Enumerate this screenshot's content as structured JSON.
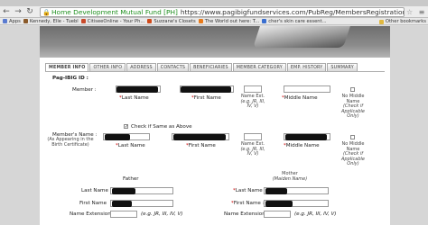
{
  "browser": {
    "site_name": "Home Development Mutual Fund [PH]",
    "url": "https://www.pagibigfundservices.com/PubReg/MembersRegistration/Registr",
    "bookmarks": [
      {
        "label": "Apps",
        "color": "#5a7bd0"
      },
      {
        "label": "Kennedy, Elle - Tuebl",
        "color": "#8a5a2a"
      },
      {
        "label": "CitiseeOnline - Your Ph...",
        "color": "#c94a2a"
      },
      {
        "label": "Suzzane's Closets",
        "color": "#d04a1a"
      },
      {
        "label": "The World out here: T...",
        "color": "#e87a1a"
      },
      {
        "label": "cher's skin care essent...",
        "color": "#3a6fd0"
      }
    ],
    "other_bookmarks": "Other bookmarks"
  },
  "tabs": [
    "MEMBER INFO",
    "OTHER INFO",
    "ADDRESS",
    "CONTACTS",
    "BENEFICIARIES",
    "MEMBER CATEGORY",
    "EMP. HISTORY",
    "SUMMARY"
  ],
  "form": {
    "pagibig_id_label": "Pag-IBIG ID :",
    "member_label": "Member :",
    "last_name": "*Last Name",
    "first_name": "*First Name",
    "name_ext": "Name Ext.",
    "name_ext_hint": "(e.g. JR, III, IV, V)",
    "middle_name": "*Middle Name",
    "no_middle_name": "No Middle Name",
    "check_if_applicable": "(Check if Applicable Only)",
    "check_same": "Check if Same as Above",
    "members_name_label": "Member's Name :",
    "members_name_hint": "(As Appearing in the Birth Certificate)",
    "father": "Father",
    "mother": "Mother",
    "maiden_name": "(Maiden Name)",
    "last_name_plain": "Last Name",
    "first_name_plain": "First Name",
    "name_extension": "Name Extension :",
    "star_last": "*Last Name :",
    "star_first": "*First Name :",
    "eg_hint": "(e.g. JR, III, IV, V)"
  }
}
